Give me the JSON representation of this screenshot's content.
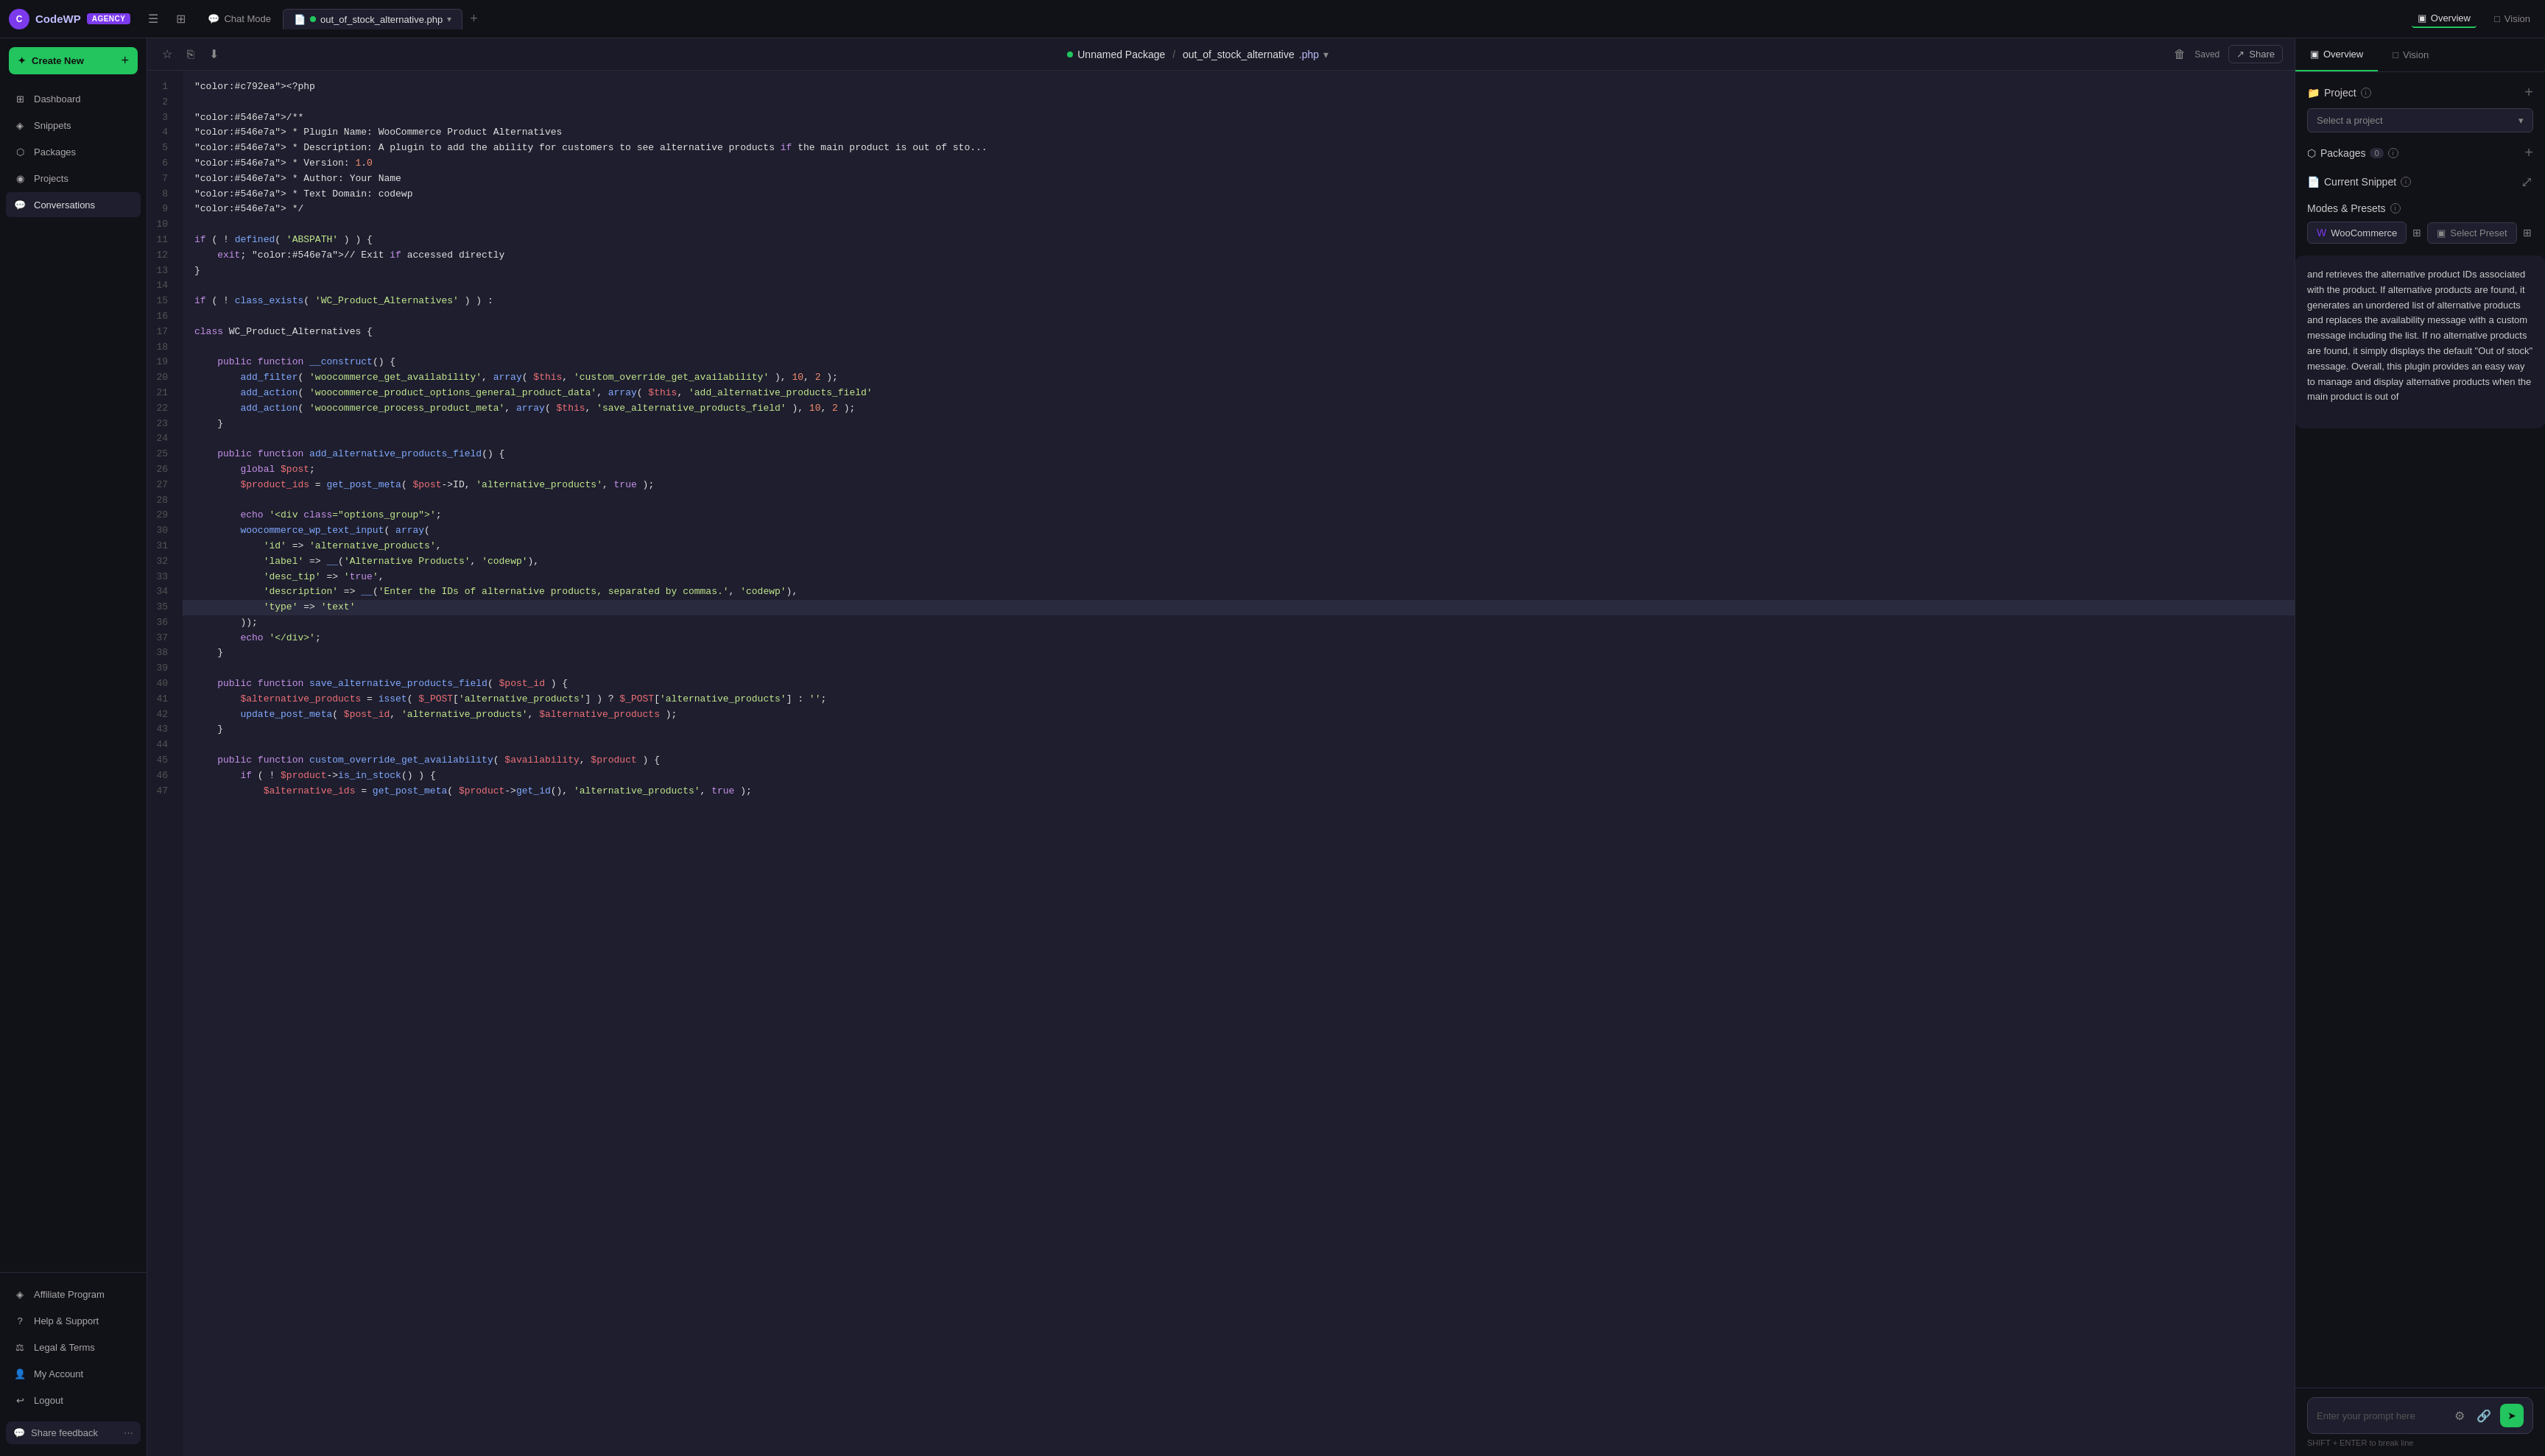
{
  "app": {
    "logo_text": "CodeWP",
    "agency_badge": "AGENCY"
  },
  "top_bar": {
    "chat_mode_tab": "Chat Mode",
    "file_tab": "out_of_stock_alternative.php",
    "overview_label": "Overview",
    "vision_label": "Vision"
  },
  "sidebar": {
    "create_new": "Create New",
    "nav_items": [
      {
        "id": "dashboard",
        "label": "Dashboard"
      },
      {
        "id": "snippets",
        "label": "Snippets"
      },
      {
        "id": "packages",
        "label": "Packages"
      },
      {
        "id": "projects",
        "label": "Projects"
      },
      {
        "id": "conversations",
        "label": "Conversations"
      }
    ],
    "bottom_items": [
      {
        "id": "affiliate",
        "label": "Affiliate Program"
      },
      {
        "id": "help",
        "label": "Help & Support"
      },
      {
        "id": "legal",
        "label": "Legal & Terms"
      },
      {
        "id": "account",
        "label": "My Account"
      },
      {
        "id": "logout",
        "label": "Logout"
      }
    ],
    "share_feedback": "Share feedback"
  },
  "editor": {
    "file_path": "Unnamed Package",
    "file_separator": "/",
    "file_name": "out_of_stock_alternative",
    "file_ext": ".php",
    "saved_label": "Saved",
    "share_label": "Share"
  },
  "right_panel": {
    "tabs": [
      "Overview",
      "Vision"
    ],
    "project_section": {
      "title": "Project",
      "select_placeholder": "Select a project"
    },
    "packages_section": {
      "title": "Packages",
      "count": "0"
    },
    "current_snippet_section": {
      "title": "Current Snippet"
    },
    "modes_section": {
      "title": "Modes & Presets",
      "mode_label": "WooCommerce",
      "preset_label": "Select Preset"
    },
    "chat_text": "and retrieves the alternative product IDs associated with the product. If alternative products are found, it generates an unordered list of alternative products and replaces the availability message with a custom message including the list. If no alternative products are found, it simply displays the default \"Out of stock\" message.\n\nOverall, this plugin provides an easy way to manage and display alternative products when the main product is out of",
    "prompt_placeholder": "Enter your prompt here",
    "prompt_hint": "SHIFT + ENTER to break line"
  },
  "code": {
    "lines": [
      {
        "num": 1,
        "text": "<?php"
      },
      {
        "num": 2,
        "text": ""
      },
      {
        "num": 3,
        "text": "/**"
      },
      {
        "num": 4,
        "text": " * Plugin Name: WooCommerce Product Alternatives"
      },
      {
        "num": 5,
        "text": " * Description: A plugin to add the ability for customers to see alternative products if the main product is out of sto..."
      },
      {
        "num": 6,
        "text": " * Version: 1.0"
      },
      {
        "num": 7,
        "text": " * Author: Your Name"
      },
      {
        "num": 8,
        "text": " * Text Domain: codewp"
      },
      {
        "num": 9,
        "text": " */"
      },
      {
        "num": 10,
        "text": ""
      },
      {
        "num": 11,
        "text": "if ( ! defined( 'ABSPATH' ) ) {"
      },
      {
        "num": 12,
        "text": "    exit; // Exit if accessed directly"
      },
      {
        "num": 13,
        "text": "}"
      },
      {
        "num": 14,
        "text": ""
      },
      {
        "num": 15,
        "text": "if ( ! class_exists( 'WC_Product_Alternatives' ) ) :"
      },
      {
        "num": 16,
        "text": ""
      },
      {
        "num": 17,
        "text": "class WC_Product_Alternatives {"
      },
      {
        "num": 18,
        "text": ""
      },
      {
        "num": 19,
        "text": "    public function __construct() {"
      },
      {
        "num": 20,
        "text": "        add_filter( 'woocommerce_get_availability', array( $this, 'custom_override_get_availability' ), 10, 2 );"
      },
      {
        "num": 21,
        "text": "        add_action( 'woocommerce_product_options_general_product_data', array( $this, 'add_alternative_products_field'"
      },
      {
        "num": 22,
        "text": "        add_action( 'woocommerce_process_product_meta', array( $this, 'save_alternative_products_field' ), 10, 2 );"
      },
      {
        "num": 23,
        "text": "    }"
      },
      {
        "num": 24,
        "text": ""
      },
      {
        "num": 25,
        "text": "    public function add_alternative_products_field() {"
      },
      {
        "num": 26,
        "text": "        global $post;"
      },
      {
        "num": 27,
        "text": "        $product_ids = get_post_meta( $post->ID, 'alternative_products', true );"
      },
      {
        "num": 28,
        "text": ""
      },
      {
        "num": 29,
        "text": "        echo '<div class=\"options_group\">';"
      },
      {
        "num": 30,
        "text": "        woocommerce_wp_text_input( array("
      },
      {
        "num": 31,
        "text": "            'id' => 'alternative_products',"
      },
      {
        "num": 32,
        "text": "            'label' => __('Alternative Products', 'codewp'),"
      },
      {
        "num": 33,
        "text": "            'desc_tip' => 'true',"
      },
      {
        "num": 34,
        "text": "            'description' => __('Enter the IDs of alternative products, separated by commas.', 'codewp'),"
      },
      {
        "num": 35,
        "text": "            'type' => 'text'"
      },
      {
        "num": 36,
        "text": "        ));"
      },
      {
        "num": 37,
        "text": "        echo '</div>';"
      },
      {
        "num": 38,
        "text": "    }"
      },
      {
        "num": 39,
        "text": ""
      },
      {
        "num": 40,
        "text": "    public function save_alternative_products_field( $post_id ) {"
      },
      {
        "num": 41,
        "text": "        $alternative_products = isset( $_POST['alternative_products'] ) ? $_POST['alternative_products'] : '';"
      },
      {
        "num": 42,
        "text": "        update_post_meta( $post_id, 'alternative_products', $alternative_products );"
      },
      {
        "num": 43,
        "text": "    }"
      },
      {
        "num": 44,
        "text": ""
      },
      {
        "num": 45,
        "text": "    public function custom_override_get_availability( $availability, $product ) {"
      },
      {
        "num": 46,
        "text": "        if ( ! $product->is_in_stock() ) {"
      },
      {
        "num": 47,
        "text": "            $alternative_ids = get_post_meta( $product->get_id(), 'alternative_products', true );"
      }
    ]
  }
}
